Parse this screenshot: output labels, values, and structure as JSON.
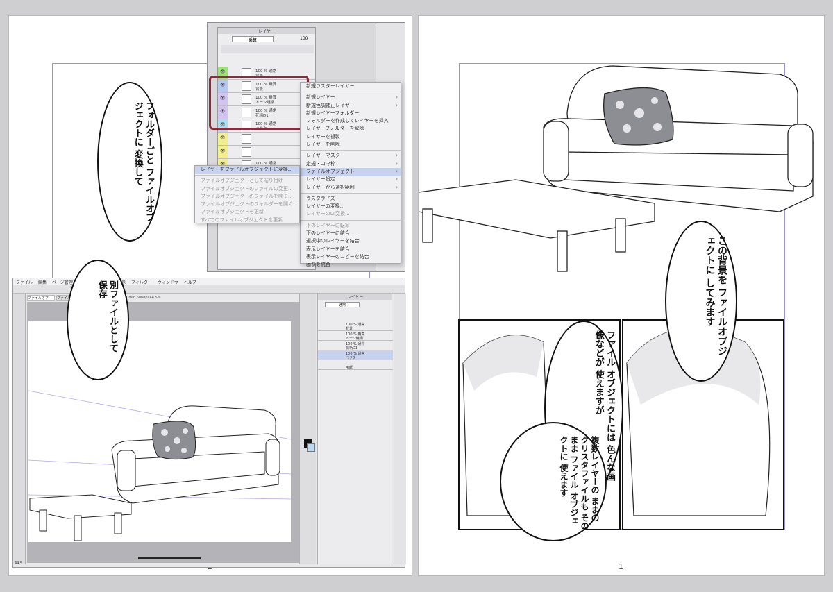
{
  "pages": {
    "left_number": "2",
    "right_number": "1"
  },
  "left_page": {
    "bubble1": "フォルダーごと ファイルオブジェクトに 変換して",
    "bubble2": "別ファイルとして 保存"
  },
  "right_page": {
    "bubble_top": "この背景を ファイルオブジェクトに してみます",
    "bubble_left": "ファイル オブジェクトには 色んな画像などが 使えますが",
    "bubble_bottom": "複数レイヤーの ままの クリスタファイルも そのまま ファイル オブジェクトに 使えます"
  },
  "layer_panel": {
    "title": "レイヤー",
    "blend_mode": "乗算",
    "opacity": "100",
    "layers": [
      {
        "name": "100 % 通常",
        "sub": "背景",
        "color": "#9fe07a"
      },
      {
        "name": "100 % 乗算",
        "sub": "背景",
        "color": "#b7c8ef"
      },
      {
        "name": "100 % 乗算",
        "sub": "トーン焼柄",
        "color": "#d3c4ef"
      },
      {
        "name": "100 % 通常",
        "sub": "花柄D1",
        "color": "#d3c4ef"
      },
      {
        "name": "100 % 通常",
        "sub": "ベクター",
        "color": "#aedcee"
      },
      {
        "name": "",
        "sub": "",
        "color": "#f0ee8e"
      },
      {
        "name": "",
        "sub": "",
        "color": "#f0ee8e"
      },
      {
        "name": "100 % 通常",
        "sub": "",
        "color": "#f0ee8e"
      }
    ]
  },
  "context_menu": {
    "items": [
      {
        "label": "新規ラスターレイヤー",
        "arrow": false,
        "state": "normal"
      },
      {
        "label": "新規レイヤー",
        "arrow": true,
        "state": "normal"
      },
      {
        "label": "新規色調補正レイヤー",
        "arrow": true,
        "state": "normal"
      },
      {
        "label": "新規レイヤーフォルダー",
        "arrow": false,
        "state": "normal"
      },
      {
        "label": "フォルダーを作成してレイヤーを挿入",
        "arrow": false,
        "state": "normal"
      },
      {
        "label": "レイヤーフォルダーを解除",
        "arrow": false,
        "state": "normal"
      },
      {
        "label": "レイヤーを複製",
        "arrow": false,
        "state": "normal"
      },
      {
        "label": "レイヤーを削除",
        "arrow": false,
        "state": "normal"
      },
      {
        "label": "レイヤーマスク",
        "arrow": true,
        "state": "normal"
      },
      {
        "label": "定規・コマ枠",
        "arrow": true,
        "state": "normal"
      },
      {
        "label": "ファイルオブジェクト",
        "arrow": true,
        "state": "selected"
      },
      {
        "label": "レイヤー設定",
        "arrow": true,
        "state": "normal"
      },
      {
        "label": "レイヤーから選択範囲",
        "arrow": true,
        "state": "normal"
      },
      {
        "label": "ラスタライズ",
        "arrow": false,
        "state": "normal"
      },
      {
        "label": "レイヤーの変換...",
        "arrow": false,
        "state": "normal"
      },
      {
        "label": "レイヤーのLT変換...",
        "arrow": false,
        "state": "disabled"
      },
      {
        "label": "下のレイヤーに転写",
        "arrow": false,
        "state": "disabled"
      },
      {
        "label": "下のレイヤーに結合",
        "arrow": false,
        "state": "normal"
      },
      {
        "label": "選択中のレイヤーを結合",
        "arrow": false,
        "state": "normal"
      },
      {
        "label": "表示レイヤーを結合",
        "arrow": false,
        "state": "normal"
      },
      {
        "label": "表示レイヤーのコピーを結合",
        "arrow": false,
        "state": "normal"
      },
      {
        "label": "画像を統合",
        "arrow": false,
        "state": "normal"
      }
    ]
  },
  "submenu": {
    "items": [
      {
        "label": "レイヤーをファイルオブジェクトに変換...",
        "state": "selected"
      },
      {
        "label": "ファイルオブジェクトとして貼り付け",
        "state": "disabled"
      },
      {
        "label": "ファイルオブジェクトのファイルの変更...",
        "state": "disabled"
      },
      {
        "label": "ファイルオブジェクトのファイルを開く...",
        "state": "disabled"
      },
      {
        "label": "ファイルオブジェクトのフォルダーを開く...",
        "state": "disabled"
      },
      {
        "label": "ファイルオブジェクトを更新",
        "state": "disabled"
      },
      {
        "label": "すべてのファイルオブジェクトを更新",
        "state": "disabled"
      }
    ]
  },
  "app_window": {
    "menu_items": [
      "ファイル",
      "編集",
      "ページ管理",
      "",
      "",
      "",
      "選択範囲",
      "表示",
      "フィルター",
      "ウィンドウ",
      "ヘルプ"
    ],
    "tab1": "ファイルオブ",
    "tab2": "ファイル",
    "canvas_info": "60mm 600dpi 44.5%",
    "layer_title": "レイヤー",
    "blend_mode": "通常",
    "layers": [
      {
        "name": "100 % 通常",
        "sub": "背景"
      },
      {
        "name": "100 % 乗算",
        "sub": "トーン焼柄"
      },
      {
        "name": "100 % 通常",
        "sub": "花柄D1"
      },
      {
        "name": "100 % 通常",
        "sub": "ベクター"
      },
      {
        "name": "",
        "sub": "用紙"
      }
    ],
    "zoom": "44.5"
  },
  "colors": {
    "highlight_box": "#8b2a3d",
    "selection": "#c7d2ee",
    "frame_guide": "#9d94c9"
  }
}
